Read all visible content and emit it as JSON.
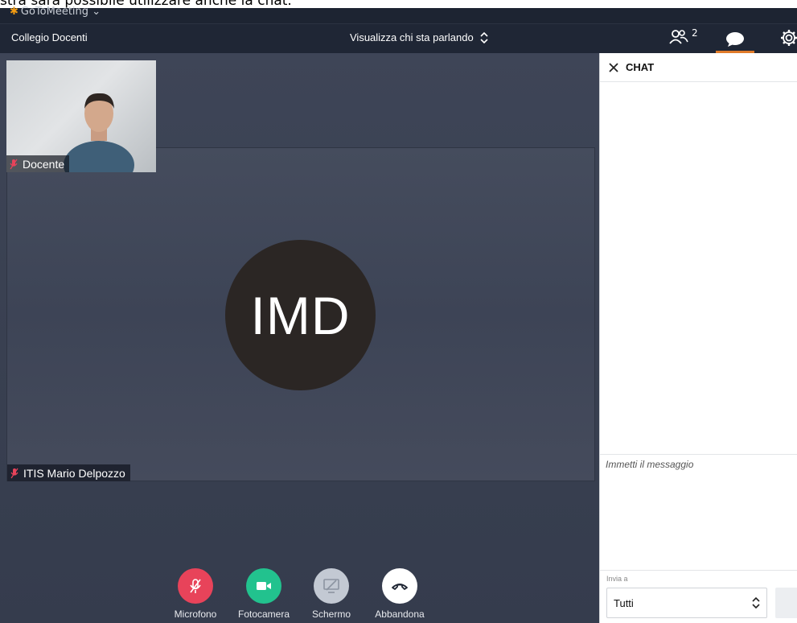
{
  "caption": "stra sarà possibile utilizzare anche la chat.",
  "app": {
    "logo_text": "GoToMeeting",
    "logo_caret": "⌄"
  },
  "topbar": {
    "meeting_title": "Collegio Docenti",
    "view_mode": "Visualizza chi sta parlando",
    "participants_count": "2"
  },
  "stage": {
    "main_participant_initials": "IMD",
    "main_participant_name": "ITIS Mario Delpozzo",
    "self_name": "Docente"
  },
  "controls": [
    {
      "label": "Microfono",
      "color": "#e8435a"
    },
    {
      "label": "Fotocamera",
      "color": "#22c28e"
    },
    {
      "label": "Schermo",
      "color": "#c3c9d3"
    },
    {
      "label": "Abbandona",
      "color": "#ffffff"
    }
  ],
  "chat": {
    "title": "CHAT",
    "input_placeholder": "Immetti il messaggio",
    "send_to_label": "Invia a",
    "send_to_value": "Tutti"
  },
  "colors": {
    "accent": "#e07b2a",
    "topbar_bg": "#1f2635",
    "stage_bg": "#3e4557"
  }
}
